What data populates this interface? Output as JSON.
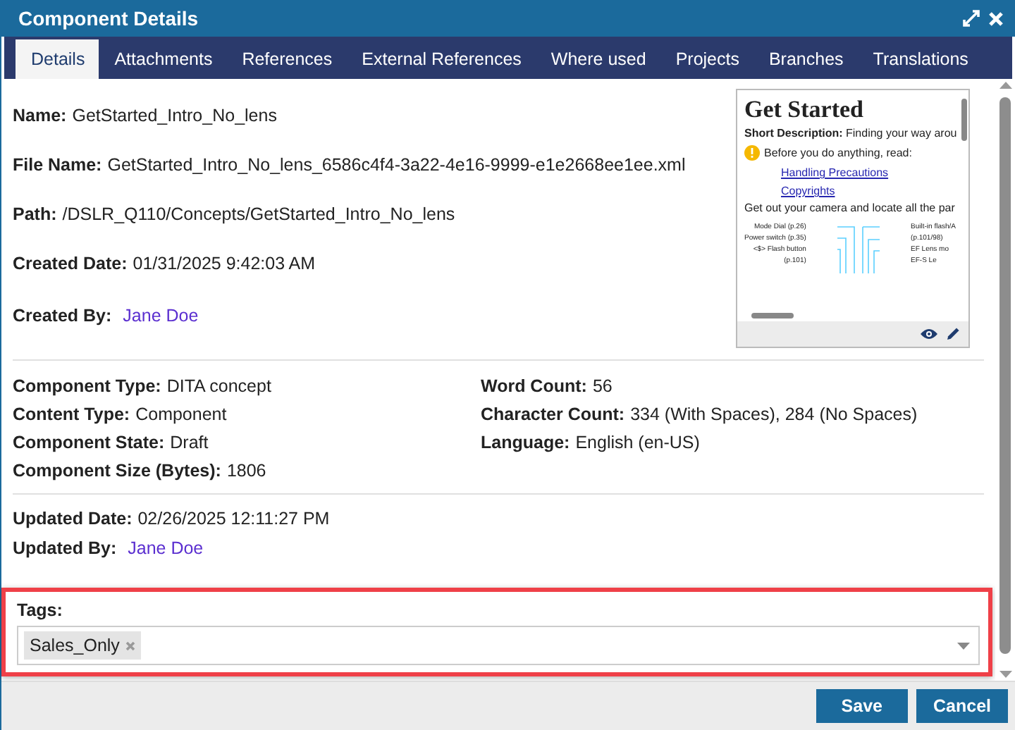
{
  "window": {
    "title": "Component Details"
  },
  "tabs": [
    {
      "label": "Details",
      "selected": true
    },
    {
      "label": "Attachments",
      "selected": false
    },
    {
      "label": "References",
      "selected": false
    },
    {
      "label": "External References",
      "selected": false
    },
    {
      "label": "Where used",
      "selected": false
    },
    {
      "label": "Projects",
      "selected": false
    },
    {
      "label": "Branches",
      "selected": false
    },
    {
      "label": "Translations",
      "selected": false
    }
  ],
  "main_fields": [
    {
      "label": "Name:",
      "value": "GetStarted_Intro_No_lens",
      "kind": "text"
    },
    {
      "label": "File Name:",
      "value": "GetStarted_Intro_No_lens_6586c4f4-3a22-4e16-9999-e1e2668ee1ee.xml",
      "kind": "text"
    },
    {
      "label": "Path:",
      "value": "/DSLR_Q110/Concepts/GetStarted_Intro_No_lens",
      "kind": "text"
    },
    {
      "label": "Created Date:",
      "value": "01/31/2025 9:42:03 AM",
      "kind": "text"
    },
    {
      "label": "Created By:",
      "value": "Jane Doe",
      "kind": "link"
    }
  ],
  "preview": {
    "heading": "Get Started",
    "short_label": "Short Description:",
    "short_text": "Finding your way arou",
    "notice": "Before you do anything, read:",
    "links": [
      "Handling Precautions",
      "Copyrights"
    ],
    "body": "Get out your camera and locate all the par",
    "callouts_left": [
      "Mode Dial (p.26)",
      "Power switch (p.35)",
      "<$> Flash button",
      "(p.101)"
    ],
    "callouts_right": [
      "Built-in flash/A",
      "(p.101/98)",
      "EF Lens mo",
      "EF-S Le"
    ]
  },
  "details_left": [
    {
      "label": "Component Type:",
      "value": "DITA concept"
    },
    {
      "label": "Content Type:",
      "value": "Component"
    },
    {
      "label": "Component State:",
      "value": "Draft"
    },
    {
      "label": "Component Size (Bytes):",
      "value": "1806"
    }
  ],
  "details_right": [
    {
      "label": "Word Count:",
      "value": "56"
    },
    {
      "label": "Character Count:",
      "value": "334 (With Spaces), 284 (No Spaces)"
    },
    {
      "label": "Language:",
      "value": "English (en-US)"
    }
  ],
  "update_fields": [
    {
      "label": "Updated Date:",
      "value": "02/26/2025 12:11:27 PM",
      "kind": "text"
    },
    {
      "label": "Updated By:",
      "value": "Jane Doe",
      "kind": "link"
    }
  ],
  "tags": {
    "label": "Tags:",
    "items": [
      "Sales_Only"
    ],
    "highlighted": true
  },
  "buttons": [
    "Save",
    "Cancel"
  ]
}
